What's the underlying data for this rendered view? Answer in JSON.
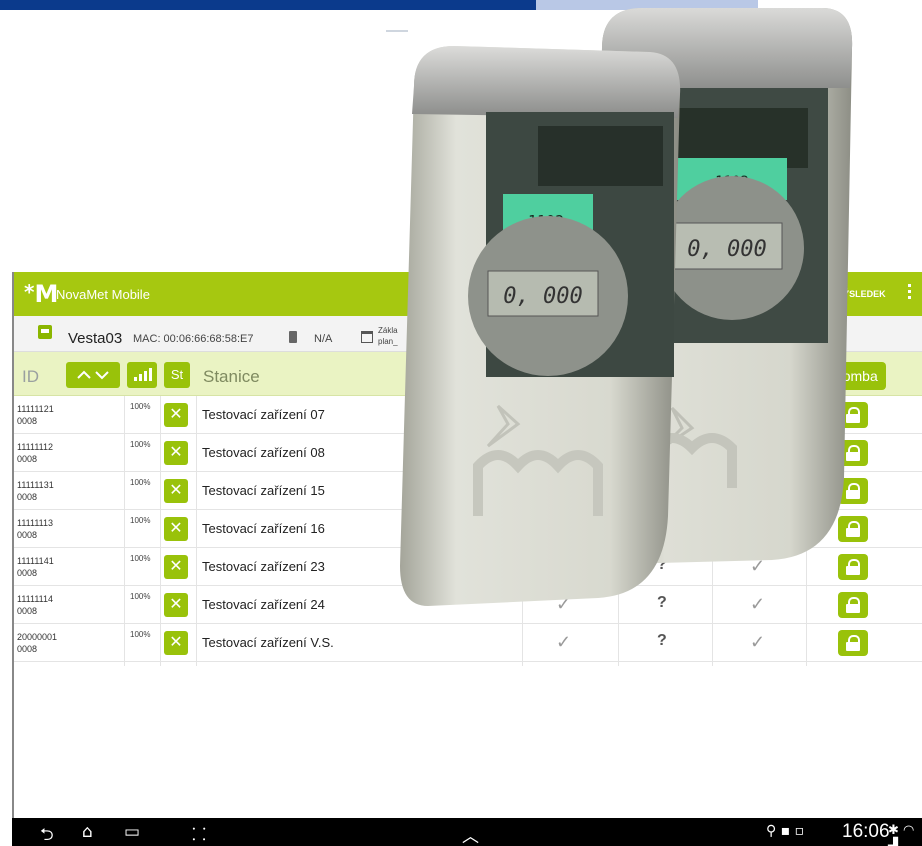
{
  "app": {
    "title": "NovaMet Mobile",
    "logo_text": "M",
    "logo_star": "*",
    "action_label": "VAT VÝSLEDEK"
  },
  "device": {
    "name": "Vesta03",
    "mac": "MAC:  00:06:66:68:58:E7",
    "battery": "N/A",
    "plan_line1": "Zákla",
    "plan_line2": "plan_"
  },
  "table": {
    "header_id": "ID",
    "header_sort": "^ v",
    "header_st": "St",
    "header_stanice": "Stanice",
    "header_plomba": "Plomba",
    "rows": [
      {
        "id1": "11111121",
        "id2": "0008",
        "signal": "100%",
        "name": "Testovací zařízení 07",
        "c1": "",
        "c2": "",
        "c3": ""
      },
      {
        "id1": "11111112",
        "id2": "0008",
        "signal": "100%",
        "name": "Testovací zařízení 08",
        "c1": "",
        "c2": "",
        "c3": ""
      },
      {
        "id1": "11111131",
        "id2": "0008",
        "signal": "100%",
        "name": "Testovací zařízení 15",
        "c1": "",
        "c2": "",
        "c3": ""
      },
      {
        "id1": "11111113",
        "id2": "0008",
        "signal": "100%",
        "name": "Testovací zařízení 16",
        "c1": "",
        "c2": "",
        "c3": ""
      },
      {
        "id1": "11111141",
        "id2": "0008",
        "signal": "100%",
        "name": "Testovací zařízení 23",
        "c1": "",
        "c2": "?",
        "c3": "✓"
      },
      {
        "id1": "11111114",
        "id2": "0008",
        "signal": "100%",
        "name": "Testovací zařízení 24",
        "c1": "✓",
        "c2": "?",
        "c3": "✓"
      },
      {
        "id1": "20000001",
        "id2": "0008",
        "signal": "100%",
        "name": "Testovací zařízení V.S.",
        "c1": "✓",
        "c2": "?",
        "c3": "✓"
      }
    ],
    "status_glyph": "✕"
  },
  "navbar": {
    "back_icon": "⮌",
    "home_icon": "⌂",
    "recent_icon": "▭",
    "screenshot_icon": "⸬",
    "up_icon": "︿",
    "status_icons": "⚲ ▪ ▫",
    "clock": "16:06",
    "status_icons2": "✱ ◠ ▟"
  },
  "meters": {
    "front_label": "1102",
    "front_display": "0, 000",
    "back_label": "1102",
    "back_display": "0, 000",
    "accent_color": "#4fcf9f"
  }
}
